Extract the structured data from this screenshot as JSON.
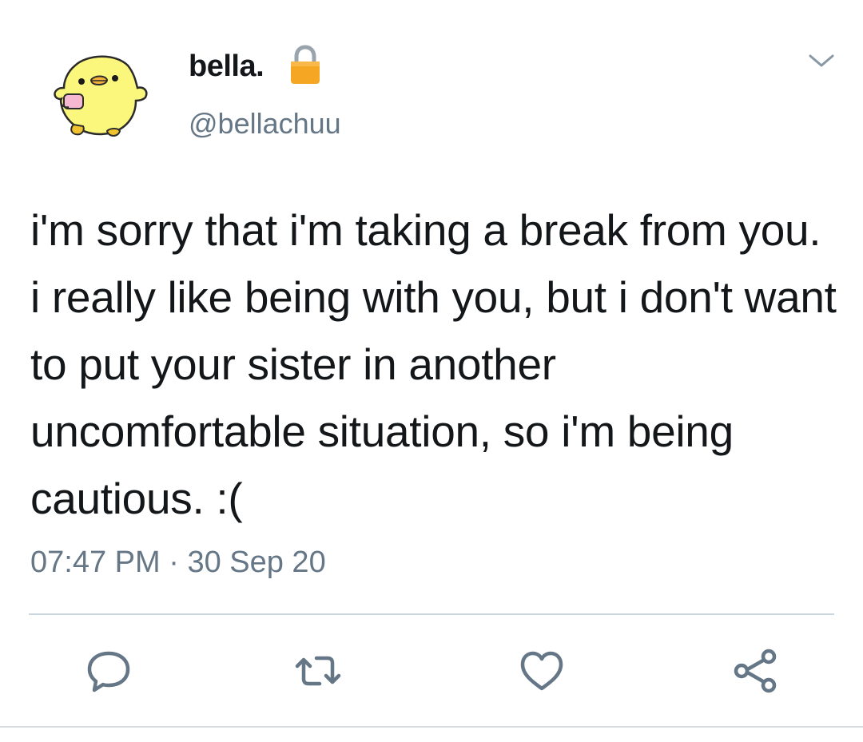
{
  "tweet": {
    "display_name": "bella.",
    "handle": "@bellachuu",
    "text": "i'm sorry that i'm taking a break from you. i really like being with you, but i don't want to put your sister in another uncomfortable situation, so i'm being cautious. :(",
    "time": "07:47 PM",
    "separator": "·",
    "date": "30 Sep 20",
    "protected": true
  },
  "icons": {
    "avatar": "yellow-chick-avatar",
    "lock": "lock-icon",
    "menu": "chevron-down-icon",
    "reply": "reply-icon",
    "retweet": "retweet-icon",
    "like": "heart-icon",
    "share": "share-icon"
  },
  "colors": {
    "text": "#14171a",
    "secondary": "#657786",
    "action_icons": "#657786",
    "divider": "#ccd6dd",
    "lock": "#f5a623",
    "avatar_yellow": "#fbf67c"
  }
}
